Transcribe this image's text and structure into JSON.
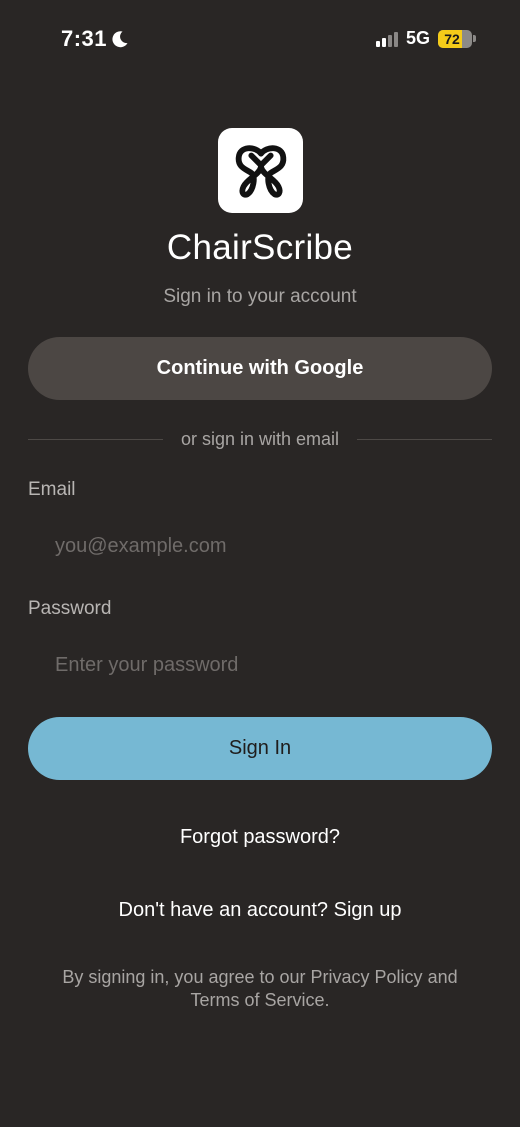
{
  "status_bar": {
    "time": "7:31",
    "network": "5G",
    "battery_level": "72",
    "battery_fraction": 0.72,
    "icons": [
      "moon-icon",
      "signal-icon",
      "battery-icon"
    ]
  },
  "app": {
    "logo_icon": "chairscribe-tooth-logo",
    "title": "ChairScribe",
    "subtitle": "Sign in to your account"
  },
  "auth": {
    "google_button_label": "Continue with Google",
    "divider_text": "or sign in with email",
    "email_label": "Email",
    "email_placeholder": "you@example.com",
    "email_value": "",
    "password_label": "Password",
    "password_placeholder": "Enter your password",
    "password_value": "",
    "sign_in_label": "Sign In",
    "forgot_password_label": "Forgot password?",
    "signup_prompt": "Don't have an account?",
    "signup_link": "Sign up",
    "terms_prefix": "By signing in, you agree to our ",
    "privacy_link": "Privacy Policy",
    "terms_and": " and ",
    "terms_link": "Terms of Service",
    "terms_suffix": "."
  },
  "colors": {
    "background": "#292625",
    "google_button": "#4c4744",
    "primary_button": "#76b8d3",
    "battery_fill": "#f5cc19",
    "muted_text": "#a8a5a3"
  }
}
